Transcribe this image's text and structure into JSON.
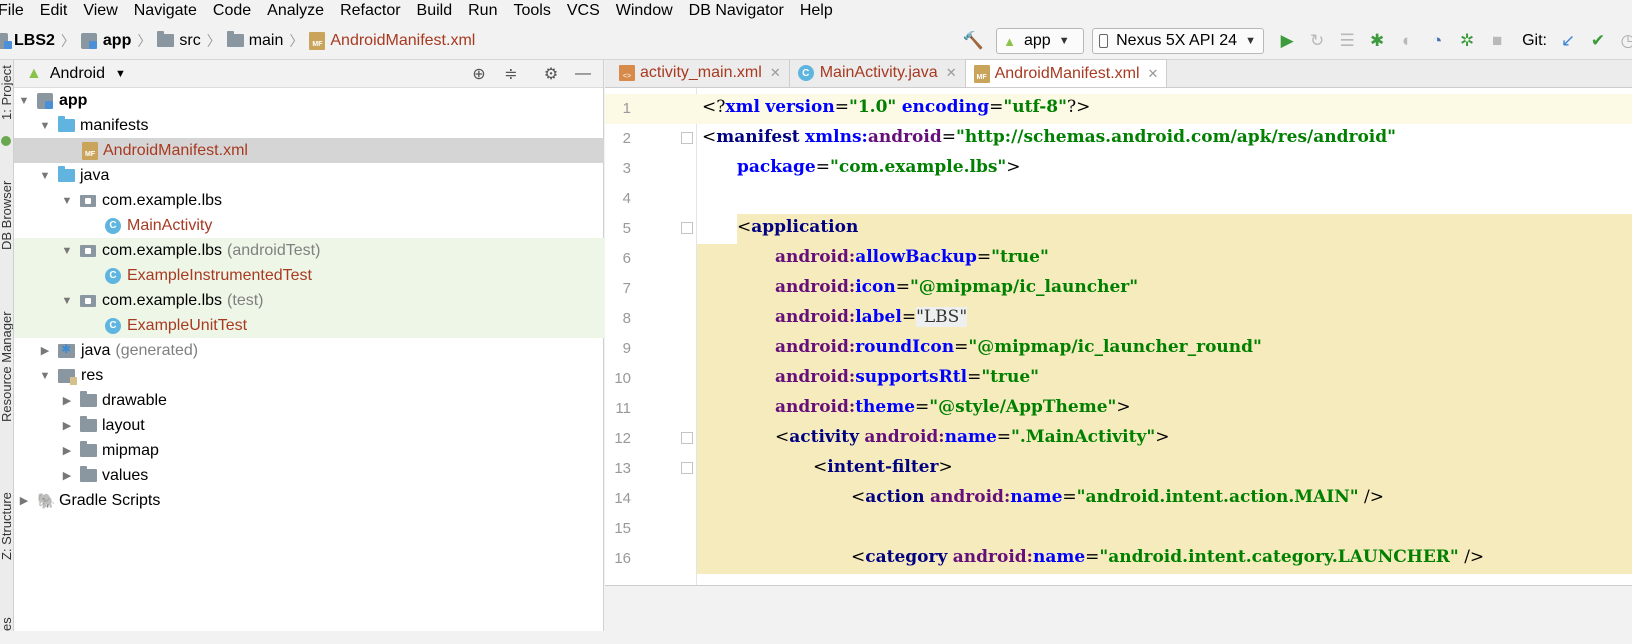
{
  "menu": [
    "File",
    "Edit",
    "View",
    "Navigate",
    "Code",
    "Analyze",
    "Refactor",
    "Build",
    "Run",
    "Tools",
    "VCS",
    "Window",
    "DB Navigator",
    "Help"
  ],
  "breadcrumb": [
    "LBS2",
    "app",
    "src",
    "main",
    "AndroidManifest.xml"
  ],
  "toolbar": {
    "config": "app",
    "device": "Nexus 5X API 24",
    "git_label": "Git:"
  },
  "side_labels": [
    "1: Project",
    "DB Browser",
    "Resource Manager",
    "Z: Structure",
    "es"
  ],
  "project": {
    "view": "Android",
    "tree": [
      {
        "label": "app",
        "suffix": ""
      },
      {
        "label": "manifests",
        "suffix": ""
      },
      {
        "label": "AndroidManifest.xml",
        "suffix": ""
      },
      {
        "label": "java",
        "suffix": ""
      },
      {
        "label": "com.example.lbs",
        "suffix": ""
      },
      {
        "label": "MainActivity",
        "suffix": ""
      },
      {
        "label": "com.example.lbs",
        "suffix": "(androidTest)"
      },
      {
        "label": "ExampleInstrumentedTest",
        "suffix": ""
      },
      {
        "label": "com.example.lbs",
        "suffix": "(test)"
      },
      {
        "label": "ExampleUnitTest",
        "suffix": ""
      },
      {
        "label": "java",
        "suffix": "(generated)"
      },
      {
        "label": "res",
        "suffix": ""
      },
      {
        "label": "drawable",
        "suffix": ""
      },
      {
        "label": "layout",
        "suffix": ""
      },
      {
        "label": "mipmap",
        "suffix": ""
      },
      {
        "label": "values",
        "suffix": ""
      },
      {
        "label": "Gradle Scripts",
        "suffix": ""
      }
    ]
  },
  "tabs": [
    "activity_main.xml",
    "MainActivity.java",
    "AndroidManifest.xml"
  ],
  "code": {
    "numbers": [
      "1",
      "2",
      "3",
      "4",
      "5",
      "6",
      "7",
      "8",
      "9",
      "10",
      "11",
      "12",
      "13",
      "14",
      "15",
      "16"
    ],
    "l1": {
      "open": "<?",
      "tag": "xml",
      "a1": "version",
      "v1": "\"1.0\"",
      "a2": "encoding",
      "v2": "\"utf-8\"",
      "close": "?>"
    },
    "l2": {
      "open": "<",
      "tag": "manifest",
      "ns": "xmlns:",
      "attr": "android",
      "val": "\"http://schemas.android.com/apk/res/android\""
    },
    "l3": {
      "attr": "package",
      "val": "\"com.example.lbs\"",
      "close": ">"
    },
    "l5": {
      "open": "<",
      "tag": "application"
    },
    "l6": {
      "ns": "android:",
      "attr": "allowBackup",
      "val": "\"true\""
    },
    "l7": {
      "ns": "android:",
      "attr": "icon",
      "val": "\"@mipmap/ic_launcher\""
    },
    "l8": {
      "ns": "android:",
      "attr": "label",
      "val": "\"LBS\""
    },
    "l9": {
      "ns": "android:",
      "attr": "roundIcon",
      "val": "\"@mipmap/ic_launcher_round\""
    },
    "l10": {
      "ns": "android:",
      "attr": "supportsRtl",
      "val": "\"true\""
    },
    "l11": {
      "ns": "android:",
      "attr": "theme",
      "val": "\"@style/AppTheme\"",
      "close": ">"
    },
    "l12": {
      "open": "<",
      "tag": "activity",
      "ns": "android:",
      "attr": "name",
      "val": "\".MainActivity\"",
      "close": ">"
    },
    "l13": {
      "open": "<",
      "tag": "intent-filter",
      "close": ">"
    },
    "l14": {
      "open": "<",
      "tag": "action",
      "ns": "android:",
      "attr": "name",
      "val": "\"android.intent.action.MAIN\"",
      "close": " />"
    },
    "l16": {
      "open": "<",
      "tag": "category",
      "ns": "android:",
      "attr": "name",
      "val": "\"android.intent.category.LAUNCHER\"",
      "close": " />"
    }
  }
}
